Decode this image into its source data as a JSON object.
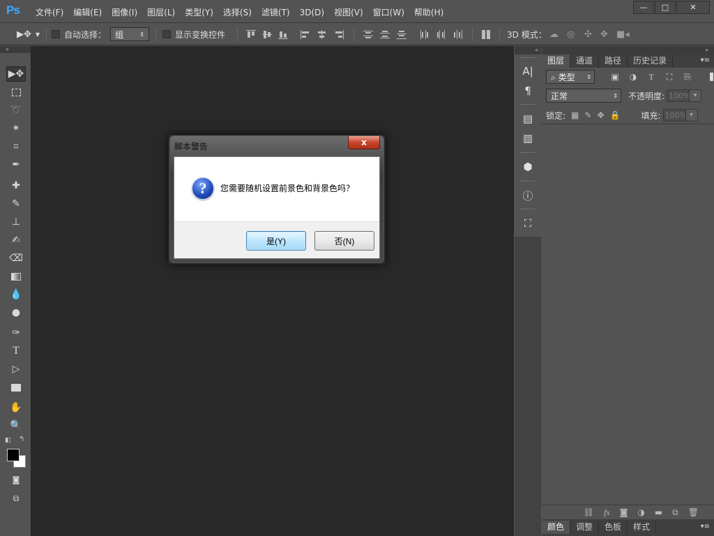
{
  "app": {
    "logo": "Ps"
  },
  "menu": [
    "文件(F)",
    "编辑(E)",
    "图像(I)",
    "图层(L)",
    "类型(Y)",
    "选择(S)",
    "滤镜(T)",
    "3D(D)",
    "视图(V)",
    "窗口(W)",
    "帮助(H)"
  ],
  "window_controls": {
    "minimize": "—",
    "maximize": "□",
    "close": "✕"
  },
  "options": {
    "auto_select_label": "自动选择：",
    "auto_select_value": "组",
    "show_transform_label": "显示变换控件",
    "mode_3d_label": "3D 模式："
  },
  "tools": [
    "move-icon",
    "marquee-icon",
    "lasso-icon",
    "magic-wand-icon",
    "crop-icon",
    "eyedropper-icon",
    "healing-brush-icon",
    "brush-icon",
    "clone-stamp-icon",
    "history-brush-icon",
    "eraser-icon",
    "gradient-icon",
    "blur-icon",
    "dodge-icon",
    "pen-icon",
    "type-icon",
    "path-selection-icon",
    "rectangle-icon",
    "hand-icon",
    "zoom-icon"
  ],
  "strip": {
    "character": "A|",
    "paragraph": "¶"
  },
  "layers_panel": {
    "tabs": [
      "图层",
      "通道",
      "路径",
      "历史记录"
    ],
    "filter_label": "类型",
    "blend_mode": "正常",
    "opacity_label": "不透明度:",
    "opacity_value": "100%",
    "lock_label": "锁定:",
    "fill_label": "填充:",
    "fill_value": "100%",
    "filter_type_icon": "T"
  },
  "bottom_tabs": [
    "颜色",
    "调整",
    "色板",
    "样式"
  ],
  "dialog": {
    "title": "脚本警告",
    "close": "x",
    "icon": "?",
    "message": "您需要随机设置前景色和背景色吗？",
    "yes_label": "是(Y)",
    "no_label": "否(N)"
  }
}
